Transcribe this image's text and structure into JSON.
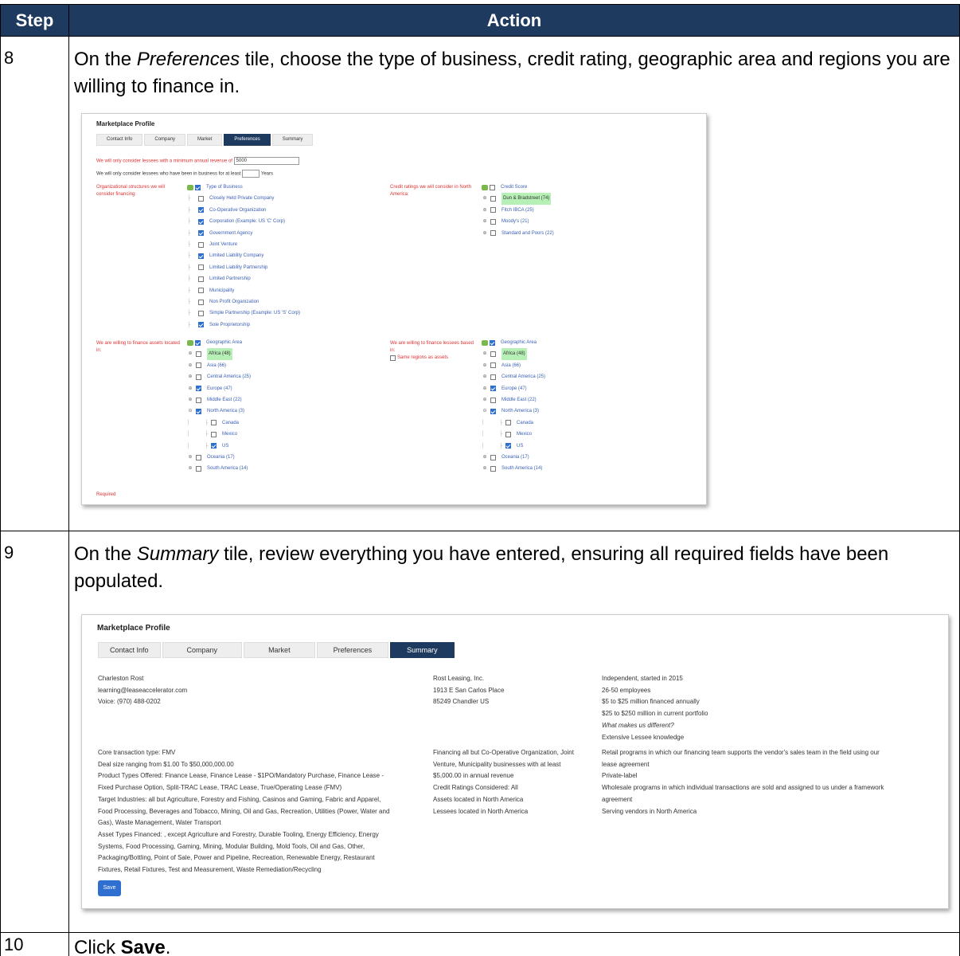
{
  "table": {
    "header_step": "Step",
    "header_action": "Action"
  },
  "step8": {
    "number": "8",
    "text_a": "On the ",
    "text_italic": "Preferences",
    "text_b": " tile, choose the type of business, credit rating, geographic area and regions you are willing to finance in.",
    "shot": {
      "title": "Marketplace Profile",
      "tabs": [
        "Contact Info",
        "Company",
        "Market",
        "Preferences",
        "Summary"
      ],
      "active_tab": "Preferences",
      "min_revenue_label": "We will only consider lessees with a minimum annual revenue of",
      "min_revenue_value": "5000",
      "years_label": "We will only consider lessees who have been in business for at least",
      "years_suffix": "Years",
      "org_label": "Organizational structures we will consider financing:",
      "business_root": "Type of Business",
      "business_items": [
        {
          "label": "Closely Held Private Company",
          "checked": false
        },
        {
          "label": "Co-Operative Organization",
          "checked": true
        },
        {
          "label": "Corporation (Example: US 'C' Corp)",
          "checked": true
        },
        {
          "label": "Government Agency",
          "checked": true
        },
        {
          "label": "Joint Venture",
          "checked": false
        },
        {
          "label": "Limited Liability Company",
          "checked": true
        },
        {
          "label": "Limited Liability Partnership",
          "checked": false
        },
        {
          "label": "Limited Partnership",
          "checked": false
        },
        {
          "label": "Municipality",
          "checked": false
        },
        {
          "label": "Non Profit Organization",
          "checked": false
        },
        {
          "label": "Simple Partnership (Example: US 'S' Corp)",
          "checked": false
        },
        {
          "label": "Sole Proprietorship",
          "checked": true
        }
      ],
      "credit_label": "Credit ratings we will consider in North America:",
      "credit_root": "Credit Score",
      "credit_items": [
        {
          "label": "Dun & Bradstreet (74)",
          "checked": false,
          "highlight": true
        },
        {
          "label": "Fitch IBCA (25)",
          "checked": false
        },
        {
          "label": "Moody's (21)",
          "checked": false
        },
        {
          "label": "Standard and Poors (22)",
          "checked": false
        }
      ],
      "assets_label": "We are willing to finance assets located in:",
      "lessees_label": "We are willing to finance lessees based in:",
      "same_regions_label": "Same regions as assets",
      "geo_root": "Geographic Area",
      "geo_items": [
        {
          "label": "Africa (48)",
          "checked": false,
          "highlight": true,
          "exp": "⊕"
        },
        {
          "label": "Asia (66)",
          "checked": false,
          "exp": "⊕"
        },
        {
          "label": "Central America (25)",
          "checked": false,
          "exp": "⊕"
        },
        {
          "label": "Europe (47)",
          "checked": true,
          "exp": "⊕"
        },
        {
          "label": "Middle East (22)",
          "checked": false,
          "exp": "⊕"
        },
        {
          "label": "North America (3)",
          "checked": true,
          "exp": "⊖"
        },
        {
          "label": "Canada",
          "checked": false,
          "child": true
        },
        {
          "label": "Mexico",
          "checked": false,
          "child": true
        },
        {
          "label": "US",
          "checked": true,
          "child": true
        },
        {
          "label": "Oceania (17)",
          "checked": false,
          "exp": "⊕"
        },
        {
          "label": "South America (14)",
          "checked": false,
          "exp": "⊕"
        }
      ],
      "required_label": "Required"
    }
  },
  "step9": {
    "number": "9",
    "text_a": "On the ",
    "text_italic": "Summary",
    "text_b": " tile, review everything you have entered, ensuring all required fields have been populated.",
    "shot": {
      "title": "Marketplace Profile",
      "tabs": [
        "Contact Info",
        "Company",
        "Market",
        "Preferences",
        "Summary"
      ],
      "active_tab": "Summary",
      "contact": [
        "Charleston Rost",
        "learning@leaseaccelerator.com",
        "Voice: (970) 488-0202"
      ],
      "company": [
        "Rost Leasing, Inc.",
        "1913 E San Carlos Place",
        "85249 Chandler US"
      ],
      "market": [
        "Independent, started in 2015",
        "26-50 employees",
        "$5 to $25 million financed annually",
        "$25 to $250 million in current portfolio"
      ],
      "market_italic": "What makes us different?",
      "market_extra": "Extensive Lessee knowledge",
      "core": [
        "Core transaction type: FMV",
        "Deal size ranging from $1.00 To $50,000,000.00",
        "Product Types Offered: Finance Lease, Finance Lease - $1PO/Mandatory Purchase, Finance Lease -",
        "Fixed Purchase Option, Split-TRAC Lease, TRAC Lease, True/Operating Lease (FMV)",
        "Target Industries: all but Agriculture, Forestry and Fishing, Casinos and Gaming, Fabric and Apparel,",
        "Food Processing, Beverages and Tobacco, Mining, Oil and Gas, Recreation, Utilities (Power, Water and",
        "Gas), Waste Management, Water Transport",
        "Asset Types Financed: , except Agriculture and Forestry, Durable Tooling, Energy Efficiency, Energy",
        "Systems, Food Processing, Gaming, Mining, Modular Building, Mold Tools, Oil and Gas, Other,",
        "Packaging/Bottling, Point of Sale, Power and Pipeline, Recreation, Renewable Energy, Restaurant",
        "Fixtures, Retail Fixtures, Test and Measurement, Waste Remediation/Recycling"
      ],
      "financing": [
        "Financing all but Co-Operative Organization, Joint",
        "Venture, Municipality businesses with at least",
        "$5,000.00 in annual revenue",
        "Credit Ratings Considered: All",
        "Assets located in North America",
        "Lessees located in North America"
      ],
      "programs": [
        "Retail programs in which our financing team supports the vendor's sales team in the field using our",
        "lease agreement",
        "Private-label",
        "Wholesale programs in which individual transactions are sold and assigned to us under a framework",
        "agreement",
        "Serving vendors in North America"
      ],
      "save_label": "Save"
    }
  },
  "step10": {
    "number": "10",
    "text_a": "Click ",
    "text_bold": "Save",
    "text_b": "."
  }
}
